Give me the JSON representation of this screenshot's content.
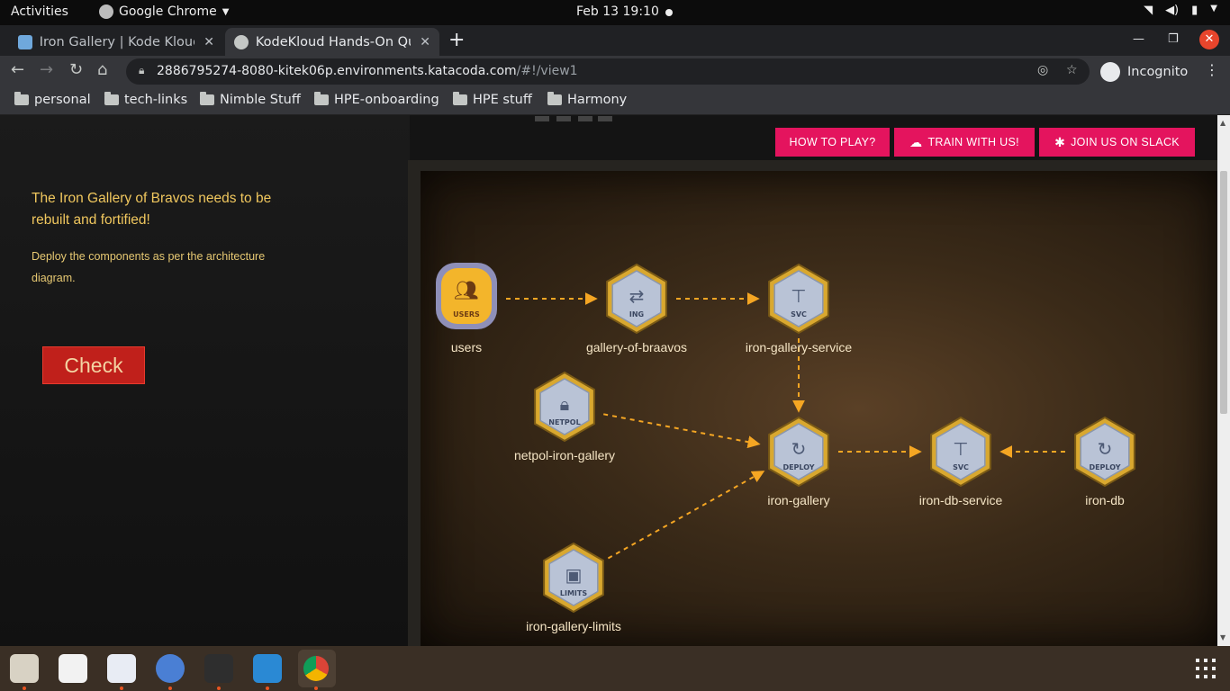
{
  "topbar": {
    "activities": "Activities",
    "app": "Google Chrome",
    "clock": "Feb 13  19:10"
  },
  "tabs": [
    {
      "title": "Iron Gallery | Kode Kloud",
      "active": false
    },
    {
      "title": "KodeKloud Hands-On Qu",
      "active": true
    }
  ],
  "toolbar": {
    "url_host": "2886795274-8080-kitek06p.environments.katacoda.com",
    "url_path": "/#!/view1",
    "profile": "Incognito"
  },
  "bookmarks": [
    "personal",
    "tech-links",
    "Nimble Stuff",
    "HPE-onboarding",
    "HPE stuff",
    "Harmony"
  ],
  "quest": {
    "title": "The Iron Gallery of Bravos needs to be rebuilt and fortified!",
    "description": "Deploy the components as per the architecture diagram.",
    "check_label": "Check"
  },
  "header_buttons": {
    "how_to_play": "HOW TO PLAY?",
    "train": "TRAIN WITH US!",
    "slack": "JOIN US ON SLACK"
  },
  "diagram": {
    "nodes": [
      {
        "id": "users",
        "label": "users",
        "badge": "USERS",
        "kind": "users"
      },
      {
        "id": "gallery-of-braavos",
        "label": "gallery-of-braavos",
        "badge": "ING",
        "kind": "ingress"
      },
      {
        "id": "iron-gallery-service",
        "label": "iron-gallery-service",
        "badge": "SVC",
        "kind": "svc"
      },
      {
        "id": "netpol-iron-gallery",
        "label": "netpol-iron-gallery",
        "badge": "NETPOL",
        "kind": "netpol"
      },
      {
        "id": "iron-gallery",
        "label": "iron-gallery",
        "badge": "DEPLOY",
        "kind": "deploy"
      },
      {
        "id": "iron-db-service",
        "label": "iron-db-service",
        "badge": "SVC",
        "kind": "svc"
      },
      {
        "id": "iron-db",
        "label": "iron-db",
        "badge": "DEPLOY",
        "kind": "deploy"
      },
      {
        "id": "iron-gallery-limits",
        "label": "iron-gallery-limits",
        "badge": "LIMITS",
        "kind": "limits"
      }
    ],
    "edges": [
      [
        "users",
        "gallery-of-braavos"
      ],
      [
        "gallery-of-braavos",
        "iron-gallery-service"
      ],
      [
        "iron-gallery-service",
        "iron-gallery"
      ],
      [
        "netpol-iron-gallery",
        "iron-gallery"
      ],
      [
        "iron-gallery-limits",
        "iron-gallery"
      ],
      [
        "iron-gallery",
        "iron-db-service"
      ],
      [
        "iron-db",
        "iron-db-service"
      ]
    ]
  },
  "colors": {
    "accent_pink": "#e4145e",
    "check_red": "#c0201b",
    "arrow_orange": "#f5a623",
    "title_gold": "#f0c75e"
  }
}
